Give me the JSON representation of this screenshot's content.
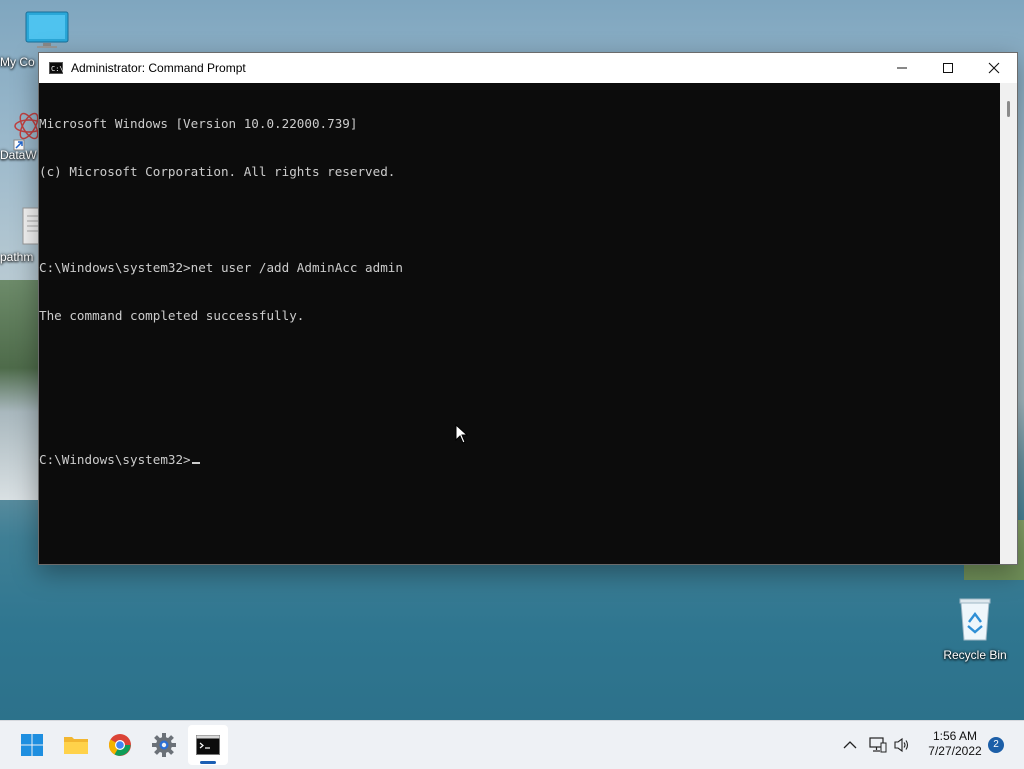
{
  "desktop": {
    "icons": [
      {
        "label": "My Co",
        "icon": "monitor-icon"
      },
      {
        "label": "DataW",
        "icon": "datawrapper-shortcut-icon"
      },
      {
        "label": "pathm",
        "icon": "document-icon"
      },
      {
        "label": "Recycle Bin",
        "icon": "recycle-bin-icon"
      }
    ]
  },
  "window": {
    "title": "Administrator: Command Prompt",
    "controls": {
      "minimize": "minimize-icon",
      "maximize": "maximize-icon",
      "close": "close-icon"
    }
  },
  "console": {
    "lines": [
      "Microsoft Windows [Version 10.0.22000.739]",
      "(c) Microsoft Corporation. All rights reserved.",
      "",
      "C:\\Windows\\system32>net user /add AdminAcc admin",
      "The command completed successfully.",
      "",
      ""
    ],
    "prompt": "C:\\Windows\\system32>"
  },
  "taskbar": {
    "apps": [
      {
        "name": "start",
        "icon": "windows-start-icon"
      },
      {
        "name": "file-explorer",
        "icon": "folder-icon"
      },
      {
        "name": "chrome",
        "icon": "chrome-icon"
      },
      {
        "name": "settings",
        "icon": "gear-icon"
      },
      {
        "name": "command-prompt",
        "icon": "terminal-icon",
        "active": true
      }
    ],
    "tray": {
      "chevron": "chevron-up-icon",
      "network": "network-icon",
      "volume": "speaker-icon"
    },
    "clock": {
      "time": "1:56 AM",
      "date": "7/27/2022"
    },
    "notifications": "2"
  },
  "colors": {
    "console_bg": "#0c0c0c",
    "console_fg": "#cccccc",
    "taskbar_bg": "#eef1f5",
    "accent": "#1a5fb4"
  }
}
